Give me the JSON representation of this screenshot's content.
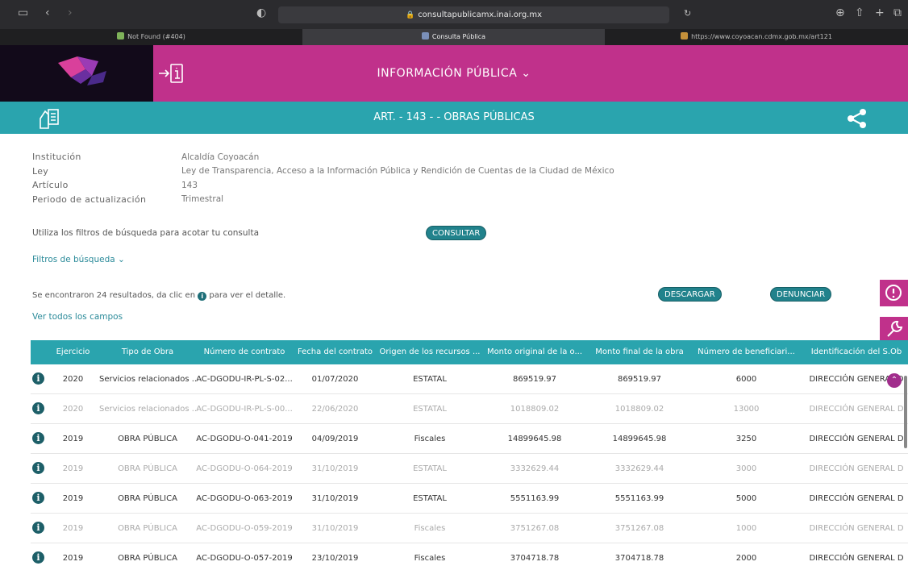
{
  "browser": {
    "url": "consultapublicamx.inai.org.mx",
    "tabs": [
      {
        "label": "Not Found (#404)",
        "active": false
      },
      {
        "label": "Consulta Pública",
        "active": true
      },
      {
        "label": "https://www.coyoacan.cdmx.gob.mx/art121",
        "active": false
      }
    ]
  },
  "header": {
    "title": "INFORMACIÓN PÚBLICA ⌄",
    "section_title": "ART. - 143 - - OBRAS PÚBLICAS"
  },
  "info": {
    "rows": [
      {
        "label": "Institución",
        "value": "Alcaldía Coyoacán"
      },
      {
        "label": "Ley",
        "value": "Ley de Transparencia, Acceso a la Información Pública y Rendición de Cuentas de la Ciudad de México"
      },
      {
        "label": "Artículo",
        "value": "143"
      },
      {
        "label": "Periodo de actualización",
        "value": "Trimestral"
      }
    ]
  },
  "search": {
    "hint": "Utiliza los filtros de búsqueda para acotar tu consulta",
    "consult_label": "CONSULTAR",
    "filters_label": "Filtros de búsqueda ⌄"
  },
  "results": {
    "prefix": "Se encontraron 24 resultados, da clic en",
    "suffix": "para ver el detalle.",
    "all_fields_label": "Ver todos los campos",
    "download_label": "DESCARGAR",
    "report_label": "DENUNCIAR"
  },
  "table": {
    "headers": [
      "Ejercicio",
      "Tipo de Obra",
      "Número de contrato",
      "Fecha del contrato",
      "Origen de los recursos ...",
      "Monto original de la o...",
      "Monto final de la obra",
      "Número de beneficiari...",
      "Identificación del S.Ob"
    ],
    "rows": [
      {
        "faint": false,
        "cells": [
          "2020",
          "Servicios relacionados ...",
          "AC-DGODU-IR-PL-S-02...",
          "01/07/2020",
          "ESTATAL",
          "869519.97",
          "869519.97",
          "6000",
          "DIRECCIÓN GENERAL D"
        ]
      },
      {
        "faint": true,
        "cells": [
          "2020",
          "Servicios relacionados ...",
          "AC-DGODU-IR-PL-S-00...",
          "22/06/2020",
          "ESTATAL",
          "1018809.02",
          "1018809.02",
          "13000",
          "DIRECCIÓN GENERAL D"
        ]
      },
      {
        "faint": false,
        "cells": [
          "2019",
          "OBRA PÚBLICA",
          "AC-DGODU-O-041-2019",
          "04/09/2019",
          "Fiscales",
          "14899645.98",
          "14899645.98",
          "3250",
          "DIRECCIÓN GENERAL D"
        ]
      },
      {
        "faint": true,
        "cells": [
          "2019",
          "OBRA PÚBLICA",
          "AC-DGODU-O-064-2019",
          "31/10/2019",
          "ESTATAL",
          "3332629.44",
          "3332629.44",
          "3000",
          "DIRECCIÓN GENERAL D"
        ]
      },
      {
        "faint": false,
        "cells": [
          "2019",
          "OBRA PÚBLICA",
          "AC-DGODU-O-063-2019",
          "31/10/2019",
          "ESTATAL",
          "5551163.99",
          "5551163.99",
          "5000",
          "DIRECCIÓN GENERAL D"
        ]
      },
      {
        "faint": true,
        "cells": [
          "2019",
          "OBRA PÚBLICA",
          "AC-DGODU-O-059-2019",
          "31/10/2019",
          "Fiscales",
          "3751267.08",
          "3751267.08",
          "1000",
          "DIRECCIÓN GENERAL D"
        ]
      },
      {
        "faint": false,
        "cells": [
          "2019",
          "OBRA PÚBLICA",
          "AC-DGODU-O-057-2019",
          "23/10/2019",
          "Fiscales",
          "3704718.78",
          "3704718.78",
          "2000",
          "DIRECCIÓN GENERAL D"
        ]
      }
    ]
  },
  "colors": {
    "magenta": "#c0318b",
    "teal": "#2aa4ae",
    "teal_dark": "#21828c"
  },
  "icons": [
    "sidebar-toggle-icon",
    "back-icon",
    "forward-icon",
    "shield-icon",
    "reload-icon",
    "download-icon",
    "share-icon",
    "plus-icon",
    "tabs-icon",
    "info-document-icon",
    "hand-document-icon",
    "share-nodes-icon",
    "alert-icon",
    "tools-icon",
    "info-icon",
    "scroll-up-icon"
  ]
}
